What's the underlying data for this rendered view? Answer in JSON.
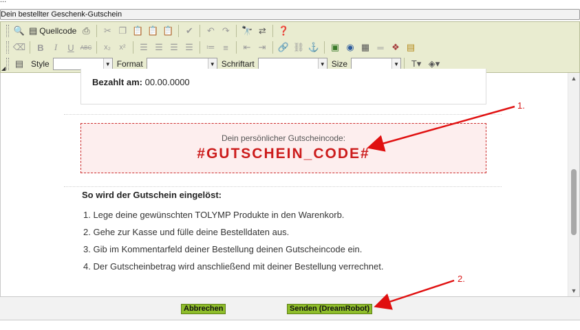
{
  "subject": {
    "value": "Dein bestellter Geschenk-Gutschein"
  },
  "toolbar": {
    "source_label": "Quellcode",
    "style_label": "Style",
    "format_label": "Format",
    "font_label": "Schriftart",
    "size_label": "Size"
  },
  "content": {
    "paid_label": "Bezahlt am:",
    "paid_value": "00.00.0000",
    "code_caption": "Dein persönlicher Gutscheincode:",
    "code_value": "#GUTSCHEIN_CODE#",
    "how_title": "So wird der Gutschein eingelöst:",
    "steps": [
      "1. Lege deine gewünschten TOLYMP Produkte in den Warenkorb.",
      "2. Gehe zur Kasse und fülle deine Bestelldaten aus.",
      "3. Gib im Kommentarfeld deiner Bestellung deinen Gutscheincode ein.",
      "4. Der Gutscheinbetrag wird anschließend mit deiner Bestellung verrechnet."
    ]
  },
  "buttons": {
    "cancel": "Abbrechen",
    "send": "Senden (DreamRobot)"
  },
  "annotations": {
    "label_1": "1.",
    "label_2": "2."
  },
  "colors": {
    "accent_red": "#cc1c1c",
    "button_green": "#8fbe2b",
    "toolbar_bg": "#e9ecd0"
  },
  "icons": [
    "preview-icon",
    "source-code-icon",
    "print-icon",
    "cut-icon",
    "copy-icon",
    "paste-icon",
    "paste-text-icon",
    "paste-word-icon",
    "spellcheck-icon",
    "undo-icon",
    "redo-icon",
    "find-icon",
    "replace-icon",
    "help-icon",
    "eraser-icon",
    "bold-icon",
    "italic-icon",
    "underline-icon",
    "strikethrough-icon",
    "subscript-icon",
    "superscript-icon",
    "align-left-icon",
    "align-center-icon",
    "align-right-icon",
    "align-justify-icon",
    "ordered-list-icon",
    "bulleted-list-icon",
    "outdent-icon",
    "indent-icon",
    "link-icon",
    "unlink-icon",
    "anchor-icon",
    "image-icon",
    "flash-icon",
    "table-icon",
    "horizontal-rule-icon",
    "special-char-icon",
    "form-icon",
    "text-color-icon",
    "background-color-icon"
  ]
}
